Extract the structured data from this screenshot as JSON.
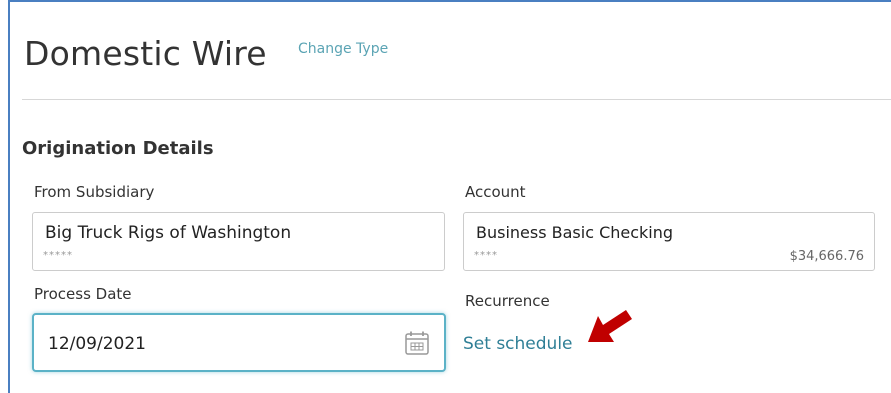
{
  "header": {
    "title": "Domestic Wire",
    "change_type_label": "Change Type"
  },
  "origination": {
    "section_title": "Origination Details",
    "from_subsidiary": {
      "label": "From Subsidiary",
      "value": "Big Truck Rigs of Washington",
      "masked_id": "*****"
    },
    "account": {
      "label": "Account",
      "value": "Business Basic Checking",
      "masked_number": "****",
      "balance": "$34,666.76"
    },
    "process_date": {
      "label": "Process Date",
      "value": "12/09/2021",
      "icon": "calendar-icon"
    },
    "recurrence": {
      "label": "Recurrence",
      "link_label": "Set schedule"
    }
  },
  "annotation": {
    "icon": "red-arrow-icon",
    "color": "#c00000"
  },
  "colors": {
    "accent": "#5bb2c7",
    "link": "#2f7f96",
    "frame": "#4a7fc1"
  }
}
